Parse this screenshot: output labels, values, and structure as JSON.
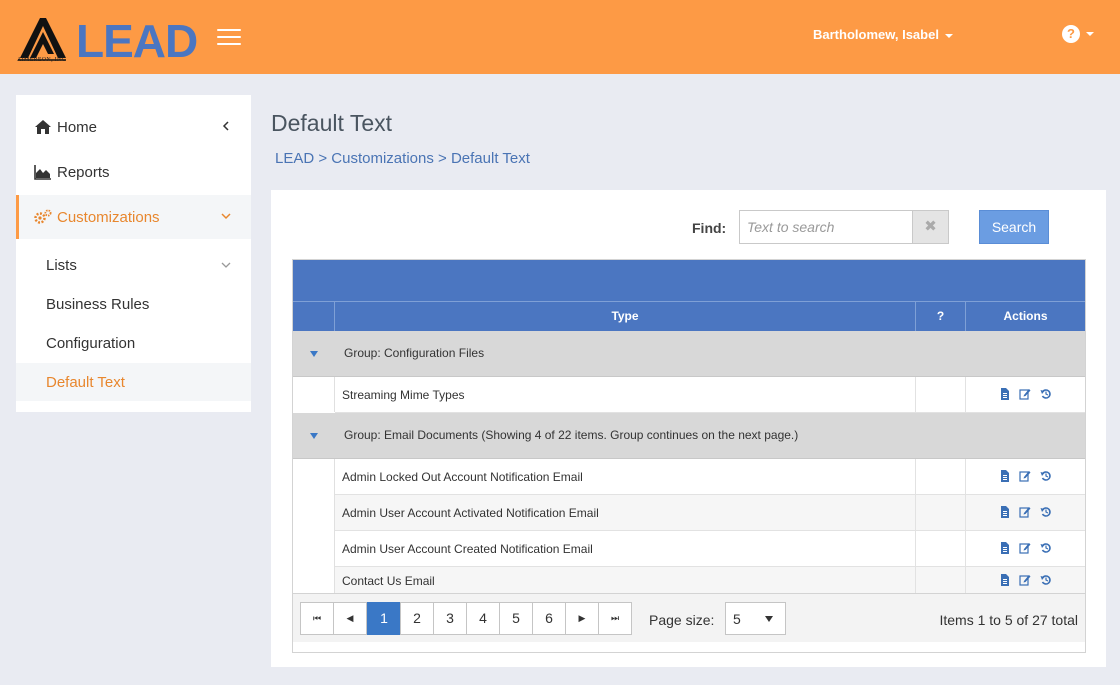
{
  "header": {
    "brand": "LEAD",
    "company": "AIMEREON, INC",
    "user": "Bartholomew, Isabel",
    "help_icon": "?",
    "menu_icon": "hamburger-icon"
  },
  "sidebar": {
    "items": [
      {
        "label": "Home",
        "icon": "home-icon"
      },
      {
        "label": "Reports",
        "icon": "area-chart-icon"
      },
      {
        "label": "Customizations",
        "icon": "gears-icon"
      }
    ],
    "subitems": [
      {
        "label": "Lists"
      },
      {
        "label": "Business Rules"
      },
      {
        "label": "Configuration"
      },
      {
        "label": "Default Text"
      }
    ]
  },
  "page": {
    "title": "Default Text",
    "breadcrumb": [
      "LEAD",
      "Customizations",
      "Default Text"
    ],
    "breadcrumb_sep": ">"
  },
  "search": {
    "label": "Find:",
    "placeholder": "Text to search",
    "clear": "✖",
    "button": "Search"
  },
  "grid": {
    "columns": {
      "type": "Type",
      "q": "?",
      "actions": "Actions"
    },
    "groups": [
      {
        "label": "Group: Configuration Files",
        "rows": [
          "Streaming Mime Types"
        ]
      },
      {
        "label": "Group: Email Documents (Showing 4 of 22 items. Group continues on the next page.)",
        "rows": [
          "Admin Locked Out Account Notification Email",
          "Admin User Account Activated Notification Email",
          "Admin User Account Created Notification Email",
          "Contact Us Email"
        ]
      }
    ]
  },
  "pager": {
    "first": "⏮",
    "prev": "◀",
    "next": "▶",
    "last": "⏭",
    "pages": [
      "1",
      "2",
      "3",
      "4",
      "5",
      "6"
    ],
    "current": "1",
    "page_size_label": "Page size:",
    "page_size": "5",
    "info": "Items 1 to 5 of 27 total"
  },
  "colors": {
    "accent": "#fd9a45",
    "grid_header": "#4b76c1",
    "link": "#4a74b4"
  }
}
